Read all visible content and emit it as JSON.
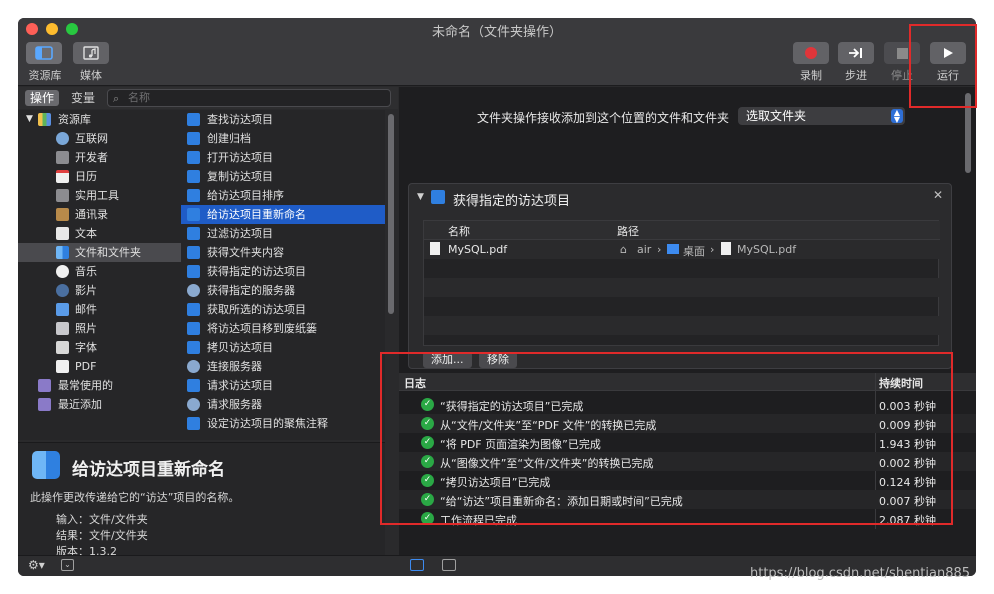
{
  "window": {
    "title": "未命名（文件夹操作）"
  },
  "toolbar": {
    "library_label": "资源库",
    "media_label": "媒体",
    "record_label": "录制",
    "step_label": "步进",
    "stop_label": "停止",
    "run_label": "运行"
  },
  "tabs": {
    "actions": "操作",
    "variables": "变量"
  },
  "search": {
    "placeholder": "名称"
  },
  "library": {
    "root": "资源库",
    "items": [
      "互联网",
      "开发者",
      "日历",
      "实用工具",
      "通讯录",
      "文本",
      "文件和文件夹",
      "音乐",
      "影片",
      "邮件",
      "照片",
      "字体",
      "PDF"
    ],
    "selected": "文件和文件夹",
    "recent_used": "最常使用的",
    "recent_added": "最近添加"
  },
  "actions": {
    "items": [
      "查找访达项目",
      "创建归档",
      "打开访达项目",
      "复制访达项目",
      "给访达项目排序",
      "给访达项目重新命名",
      "过滤访达项目",
      "获得文件夹内容",
      "获得指定的访达项目",
      "获得指定的服务器",
      "获取所选的访达项目",
      "将访达项目移到废纸篓",
      "拷贝访达项目",
      "连接服务器",
      "请求访达项目",
      "请求服务器",
      "设定访达项目的聚焦注释"
    ],
    "selected": "给访达项目重新命名"
  },
  "description": {
    "title": "给访达项目重新命名",
    "text": "此操作更改传递给它的“访达”项目的名称。",
    "input_label": "输入：",
    "input_value": "文件/文件夹",
    "result_label": "结果：",
    "result_value": "文件/文件夹",
    "version_label": "版本：",
    "version_value": "1.3.2"
  },
  "workflow": {
    "receive_label": "文件夹操作接收添加到这个位置的文件和文件夹",
    "receive_select": "选取文件夹",
    "card_title": "获得指定的访达项目",
    "col_name": "名称",
    "col_path": "路径",
    "file_name": "MySQL.pdf",
    "path_home": "air",
    "path_desktop": "桌面",
    "path_file": "MySQL.pdf",
    "add_button": "添加...",
    "remove_button": "移除"
  },
  "log": {
    "col_log": "日志",
    "col_duration": "持续时间",
    "rows": [
      {
        "msg": "“获得指定的访达项目”已完成",
        "dur": "0.003 秒钟"
      },
      {
        "msg": "从“文件/文件夹”至“PDF 文件”的转换已完成",
        "dur": "0.009 秒钟"
      },
      {
        "msg": "“将 PDF 页面渲染为图像”已完成",
        "dur": "1.943 秒钟"
      },
      {
        "msg": "从“图像文件”至“文件/文件夹”的转换已完成",
        "dur": "0.002 秒钟"
      },
      {
        "msg": "“拷贝访达项目”已完成",
        "dur": "0.124 秒钟"
      },
      {
        "msg": "“给“访达”项目重新命名：添加日期或时间”已完成",
        "dur": "0.007 秒钟"
      },
      {
        "msg": "工作流程已完成",
        "dur": "2.087 秒钟"
      }
    ]
  },
  "watermark": "https://blog.csdn.net/shentian885",
  "colors": {
    "accent": "#1f5cc7",
    "success": "#2aa845",
    "annotation": "#e02a2a"
  }
}
